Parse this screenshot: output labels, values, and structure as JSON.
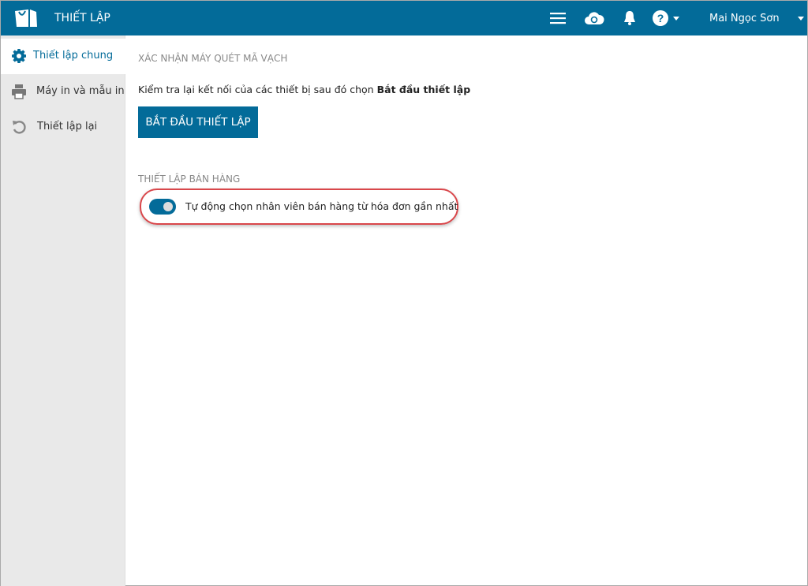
{
  "header": {
    "title": "THIẾT LẬP",
    "user_name": "Mai Ngọc Sơn",
    "icons": [
      "menu-icon",
      "cloud-sync-icon",
      "bell-icon",
      "help-icon"
    ]
  },
  "sidebar": {
    "items": [
      {
        "label": "Thiết lập chung",
        "icon": "gear-icon",
        "active": true
      },
      {
        "label": "Máy in và mẫu in",
        "icon": "printer-icon"
      },
      {
        "label": "Thiết lập lại",
        "icon": "reset-icon"
      }
    ]
  },
  "main": {
    "barcode_section": "XÁC NHẬN MÁY QUÉT MÃ VẠCH",
    "description": "Kiểm tra lại kết nối của các thiết bị sau đó chọn ",
    "description_bold": "Bắt đầu thiết lập",
    "start_button": "BẮT ĐẦU THIẾT LẬP",
    "sales_section": "THIẾT LẬP BÁN HÀNG",
    "toggle_label": "Tự động chọn nhân viên bán hàng từ hóa đơn gần nhất",
    "toggle_on": true
  },
  "colors": {
    "brand": "#036b99",
    "highlight": "#d9474b"
  }
}
